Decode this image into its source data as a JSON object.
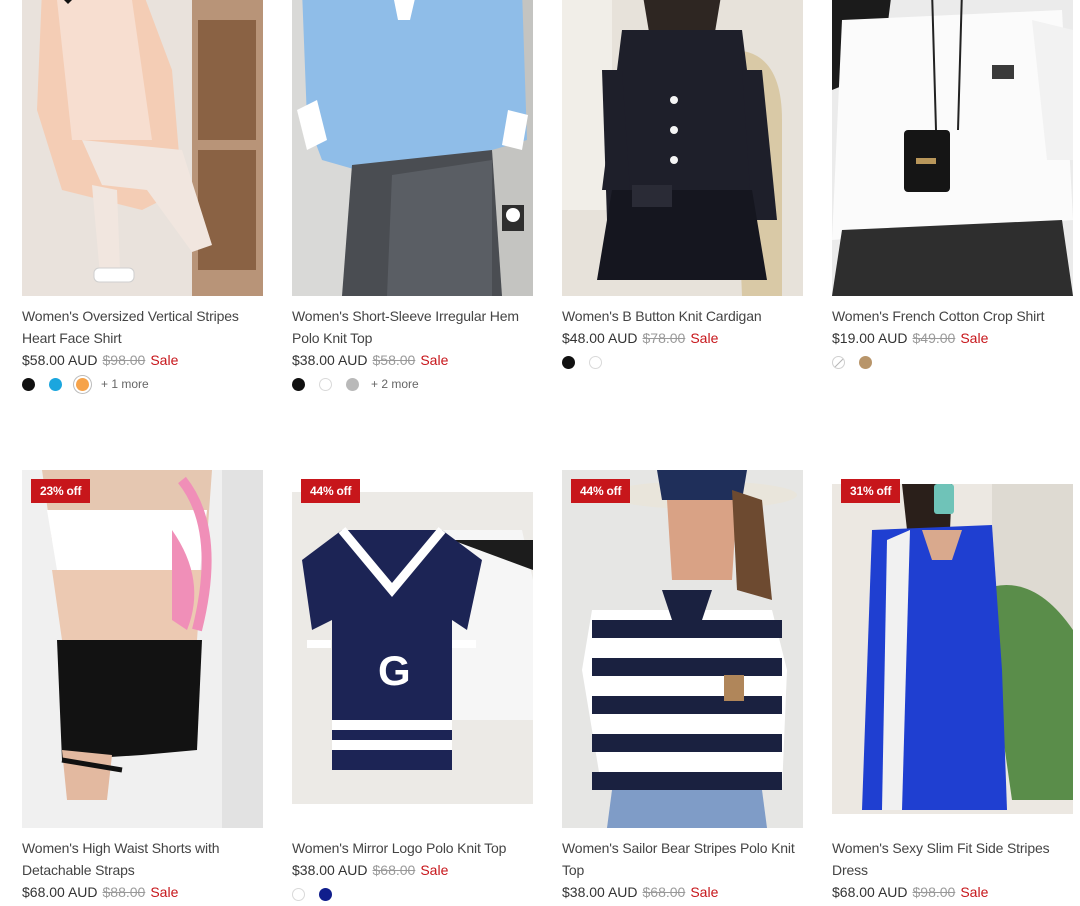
{
  "products": [
    {
      "title": "Women's Oversized Vertical Stripes Heart Face Shirt",
      "price": "$58.00 AUD",
      "compare_price": "$98.00",
      "sale_label": "Sale",
      "badge": "",
      "swatches": [
        {
          "color": "#111111"
        },
        {
          "color": "#1ba6de"
        },
        {
          "color": "#f6a34a",
          "selected": true
        }
      ],
      "more_colors": "+ 1 more"
    },
    {
      "title": "Women's Short-Sleeve Irregular Hem Polo Knit Top",
      "price": "$38.00 AUD",
      "compare_price": "$58.00",
      "sale_label": "Sale",
      "badge": "",
      "swatches": [
        {
          "color": "#111111"
        },
        {
          "color": "#ffffff"
        },
        {
          "color": "#b9b9b9"
        }
      ],
      "more_colors": "+ 2 more"
    },
    {
      "title": "Women's B Button Knit Cardigan",
      "price": "$48.00 AUD",
      "compare_price": "$78.00",
      "sale_label": "Sale",
      "badge": "",
      "swatches": [
        {
          "color": "#111111"
        },
        {
          "color": "#ffffff"
        }
      ],
      "more_colors": ""
    },
    {
      "title": "Women's French Cotton Crop Shirt",
      "price": "$19.00 AUD",
      "compare_price": "$49.00",
      "sale_label": "Sale",
      "badge": "",
      "swatches": [
        {
          "color": "#ffffff",
          "unavailable": true
        },
        {
          "color": "#b8956a"
        }
      ],
      "more_colors": ""
    },
    {
      "title": "Women's High Waist Shorts with Detachable Straps",
      "price": "$68.00 AUD",
      "compare_price": "$88.00",
      "sale_label": "Sale",
      "badge": "23% off",
      "swatches": [],
      "more_colors": ""
    },
    {
      "title": "Women's Mirror Logo Polo Knit Top",
      "price": "$38.00 AUD",
      "compare_price": "$68.00",
      "sale_label": "Sale",
      "badge": "44% off",
      "swatches": [
        {
          "color": "#ffffff"
        },
        {
          "color": "#101e8c"
        }
      ],
      "more_colors": ""
    },
    {
      "title": "Women's Sailor Bear Stripes Polo Knit Top",
      "price": "$38.00 AUD",
      "compare_price": "$68.00",
      "sale_label": "Sale",
      "badge": "44% off",
      "swatches": [],
      "more_colors": ""
    },
    {
      "title": "Women's Sexy Slim Fit Side Stripes Dress",
      "price": "$68.00 AUD",
      "compare_price": "$98.00",
      "sale_label": "Sale",
      "badge": "31% off",
      "swatches": [],
      "more_colors": ""
    }
  ],
  "colors": {
    "sale_red": "#c7161b",
    "text": "#444444",
    "muted": "#9a9a9a"
  }
}
